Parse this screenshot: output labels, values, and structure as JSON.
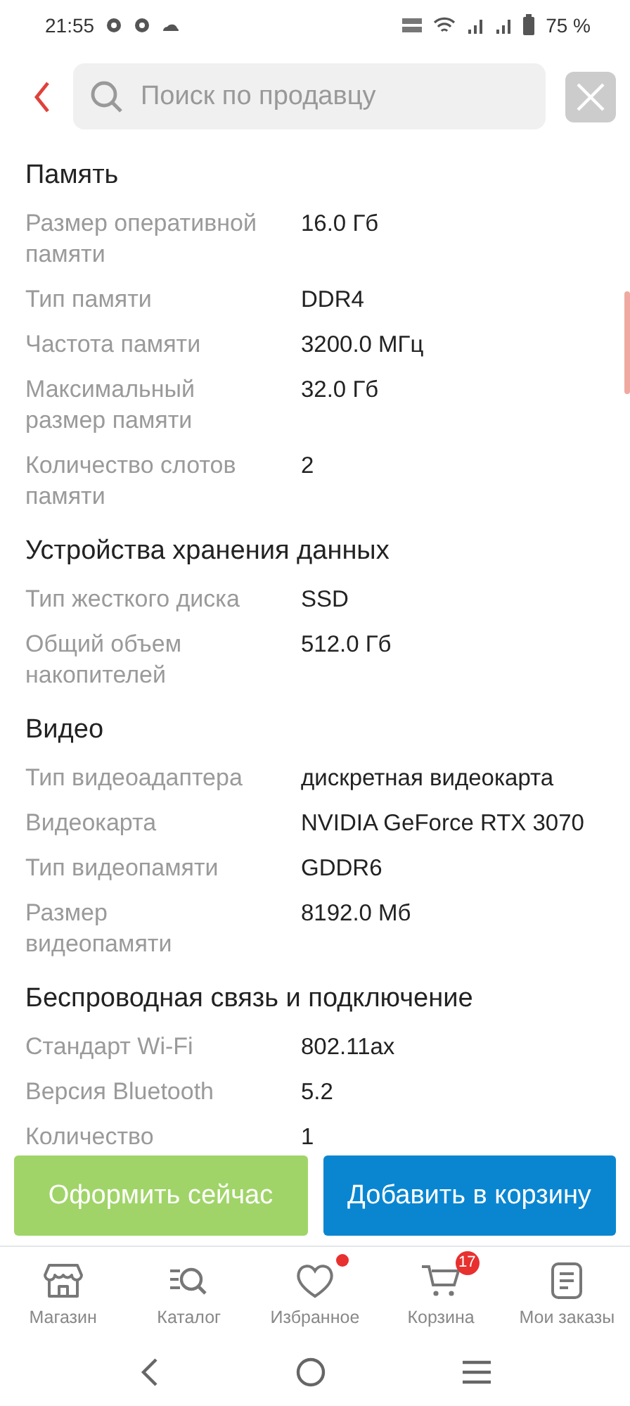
{
  "status_bar": {
    "time": "21:55",
    "battery": "75 %"
  },
  "header": {
    "search": {
      "placeholder": "Поиск по продавцу"
    }
  },
  "sections": [
    {
      "title": "Память",
      "rows": [
        {
          "label": "Размер оперативной памяти",
          "value": "16.0 Гб"
        },
        {
          "label": "Тип памяти",
          "value": "DDR4"
        },
        {
          "label": "Частота памяти",
          "value": "3200.0 МГц"
        },
        {
          "label": "Максимальный размер памяти",
          "value": "32.0 Гб"
        },
        {
          "label": "Количество слотов памяти",
          "value": "2"
        }
      ]
    },
    {
      "title": "Устройства хранения данных",
      "rows": [
        {
          "label": "Тип жесткого диска",
          "value": "SSD"
        },
        {
          "label": "Общий объем накопителей",
          "value": "512.0 Гб"
        }
      ]
    },
    {
      "title": "Видео",
      "rows": [
        {
          "label": "Тип видеоадаптера",
          "value": "дискретная видеокарта"
        },
        {
          "label": "Видеокарта",
          "value": "NVIDIA GeForce RTX 3070"
        },
        {
          "label": "Тип видеопамяти",
          "value": "GDDR6"
        },
        {
          "label": "Размер видеопамяти",
          "value": "8192.0 Мб"
        }
      ]
    },
    {
      "title": "Беспроводная связь и подключение",
      "rows": [
        {
          "label": "Стандарт Wi-Fi",
          "value": "802.11ax"
        },
        {
          "label": "Версия Bluetooth",
          "value": "5.2"
        },
        {
          "label": "Количество",
          "value": "1"
        }
      ]
    }
  ],
  "actions": [
    {
      "label": "Оформить сейчас",
      "kind": "secondary"
    },
    {
      "label": "Добавить в корзину",
      "kind": "primary"
    }
  ],
  "bottom_nav": [
    {
      "label": "Магазин",
      "kind": "shop"
    },
    {
      "label": "Каталог",
      "kind": "catalog"
    },
    {
      "label": "Избранное",
      "kind": "favorites",
      "dot": true
    },
    {
      "label": "Корзина",
      "kind": "cart",
      "badge": "17"
    },
    {
      "label": "Мои заказы",
      "kind": "orders"
    }
  ]
}
